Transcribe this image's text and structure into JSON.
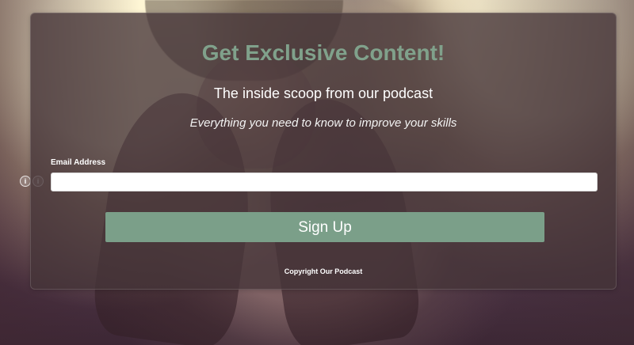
{
  "form": {
    "title": "Get Exclusive Content!",
    "subtitle": "The inside scoop from our podcast",
    "tagline": "Everything you need to know to improve your skills",
    "email_label": "Email Address",
    "email_value": "",
    "submit_label": "Sign Up",
    "copyright": "Copyright Our Podcast"
  },
  "controls": {
    "left_icons": [
      {
        "name": "info-icon",
        "glyph": "i"
      },
      {
        "name": "info-icon",
        "glyph": "i"
      }
    ]
  },
  "colors": {
    "accent": "#7b9f89",
    "title": "#80a18b",
    "panel": "#453538"
  }
}
